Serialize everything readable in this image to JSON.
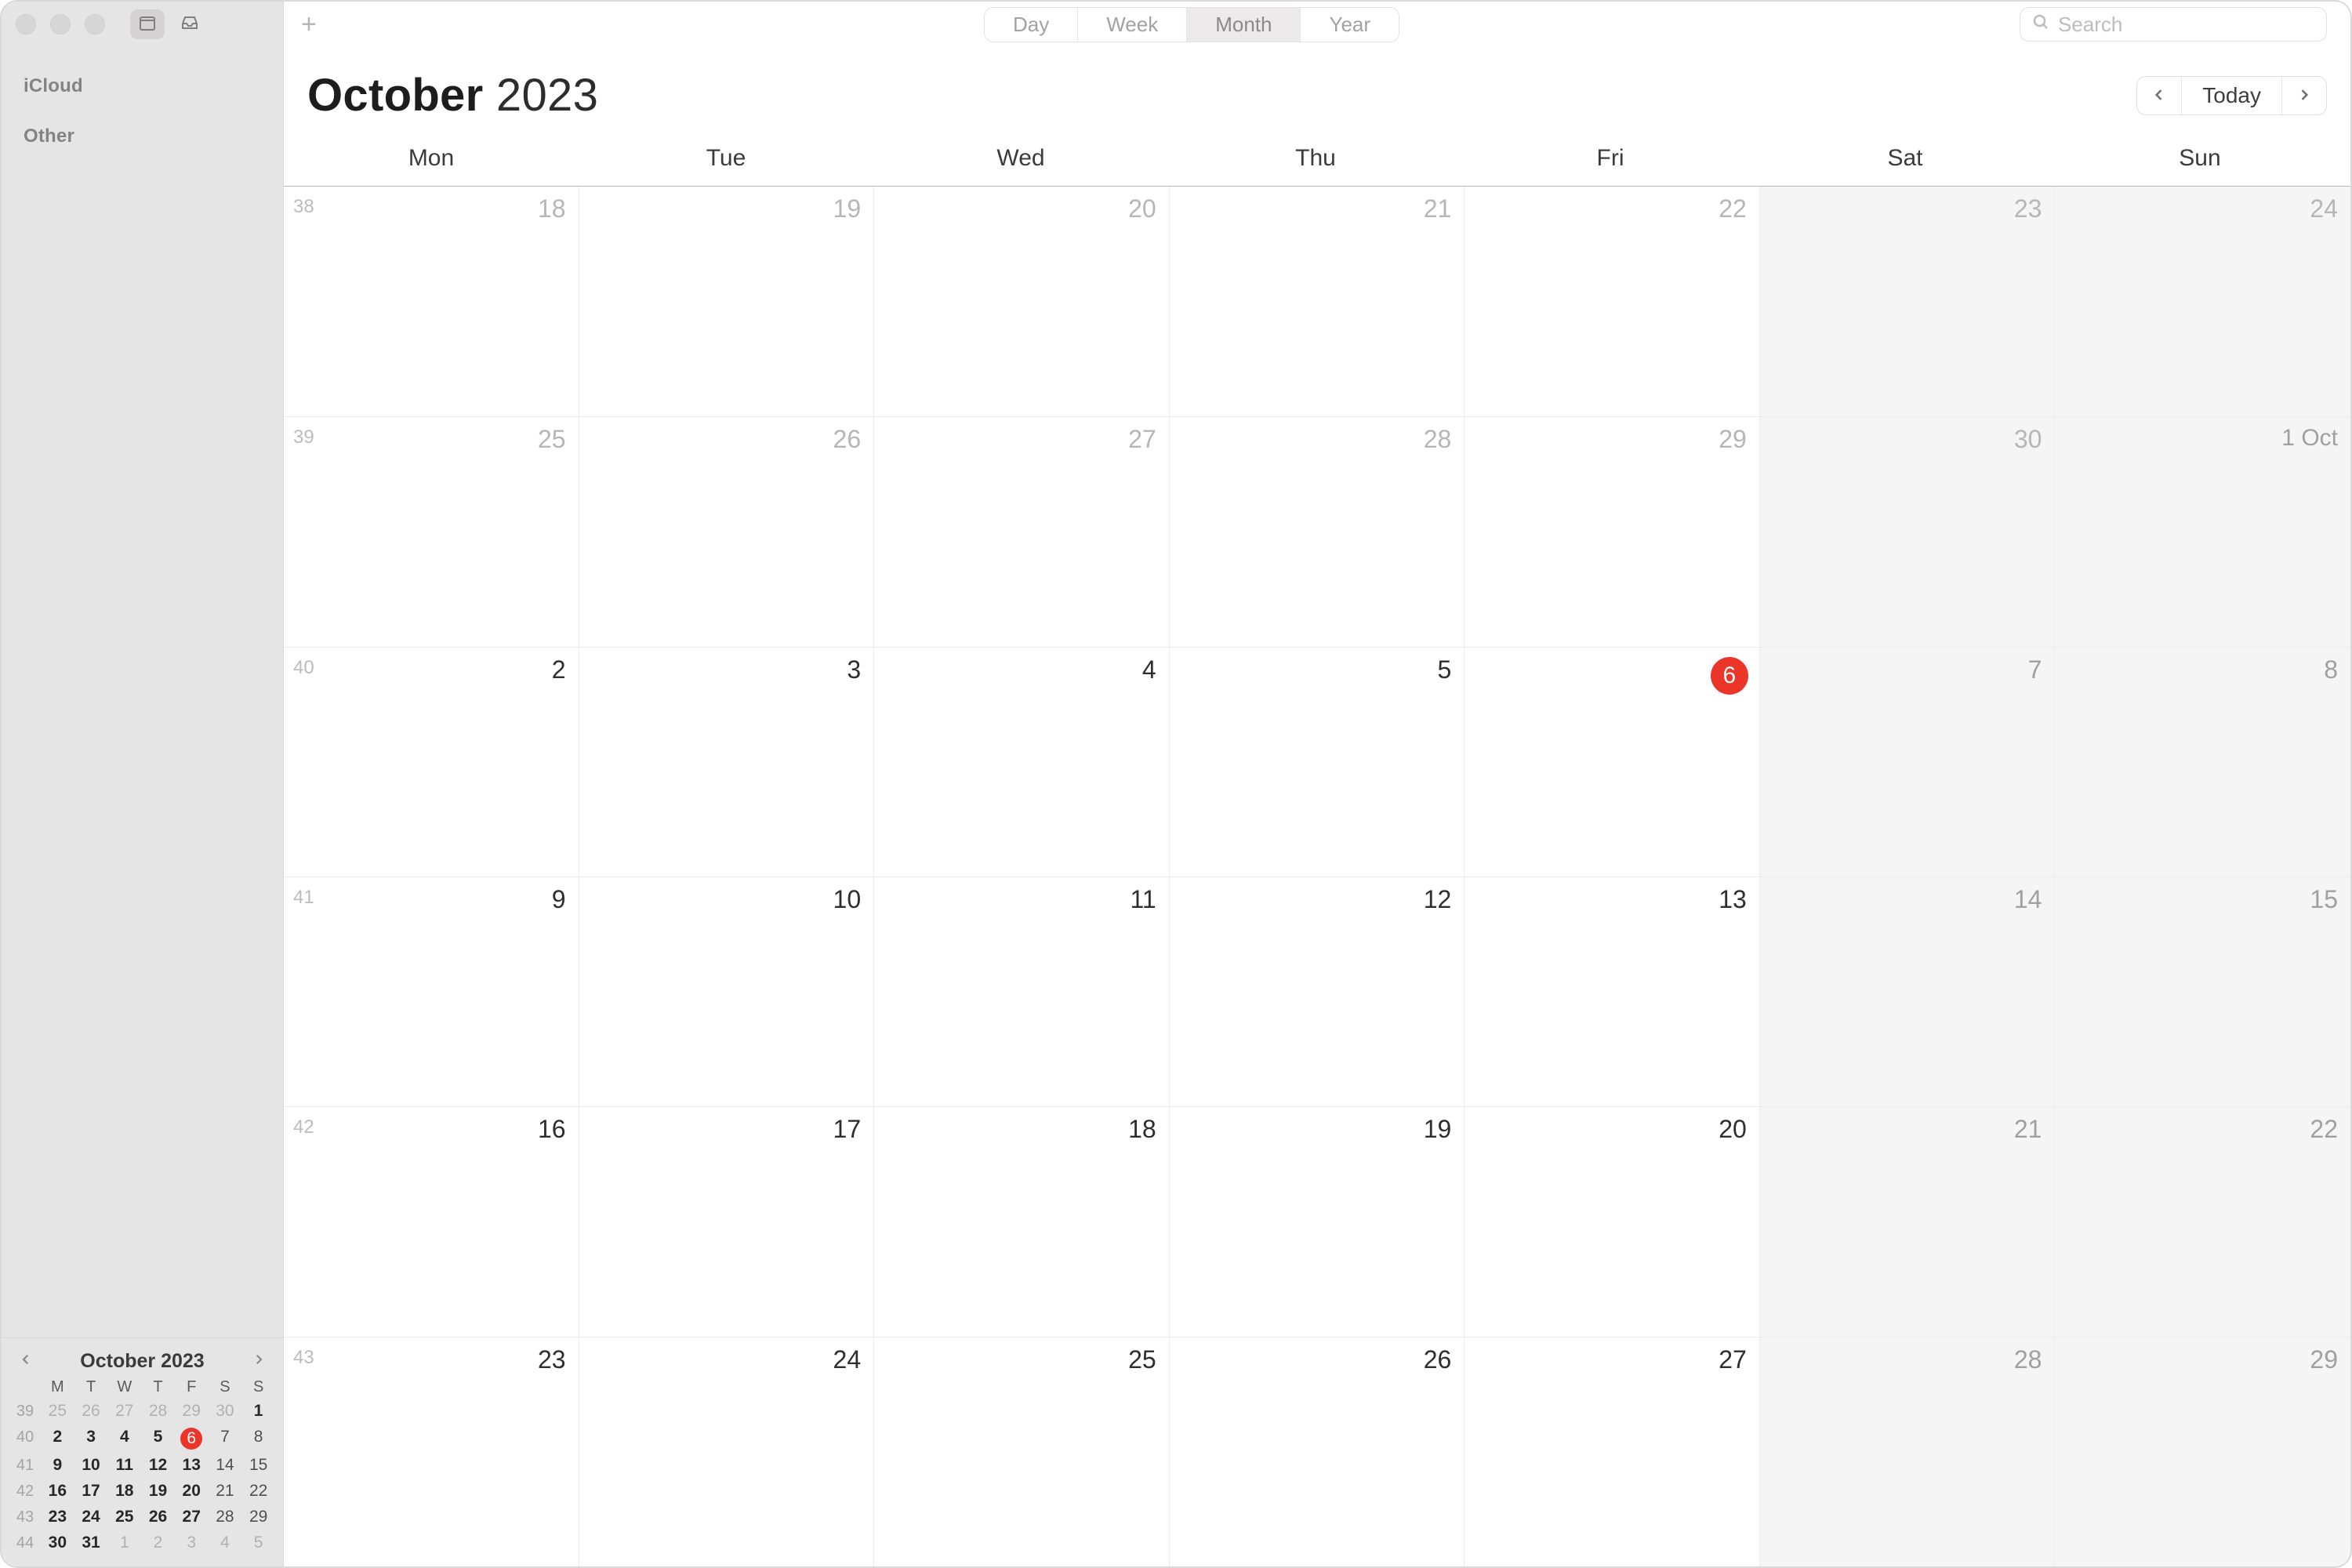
{
  "titlebar": {
    "sidebar_icon": "calendars-icon",
    "inbox_icon": "tray-icon"
  },
  "sidebar": {
    "sections": [
      "iCloud",
      "Other"
    ]
  },
  "toolbar": {
    "views": [
      "Day",
      "Week",
      "Month",
      "Year"
    ],
    "active_view": "Month",
    "search_placeholder": "Search"
  },
  "header": {
    "month": "October",
    "year": "2023",
    "today_label": "Today"
  },
  "day_headers": [
    "Mon",
    "Tue",
    "Wed",
    "Thu",
    "Fri",
    "Sat",
    "Sun"
  ],
  "weeks": [
    {
      "wk": "38",
      "days": [
        {
          "n": "18",
          "dim": true
        },
        {
          "n": "19",
          "dim": true
        },
        {
          "n": "20",
          "dim": true
        },
        {
          "n": "21",
          "dim": true
        },
        {
          "n": "22",
          "dim": true
        },
        {
          "n": "23",
          "dim": true,
          "weekend": true
        },
        {
          "n": "24",
          "dim": true,
          "weekend": true
        }
      ]
    },
    {
      "wk": "39",
      "days": [
        {
          "n": "25",
          "dim": true
        },
        {
          "n": "26",
          "dim": true
        },
        {
          "n": "27",
          "dim": true
        },
        {
          "n": "28",
          "dim": true
        },
        {
          "n": "29",
          "dim": true
        },
        {
          "n": "30",
          "dim": true,
          "weekend": true
        },
        {
          "n": "1 Oct",
          "weekend": true,
          "first": true
        }
      ]
    },
    {
      "wk": "40",
      "days": [
        {
          "n": "2"
        },
        {
          "n": "3"
        },
        {
          "n": "4"
        },
        {
          "n": "5"
        },
        {
          "n": "6",
          "today": true
        },
        {
          "n": "7",
          "weekend": true
        },
        {
          "n": "8",
          "weekend": true
        }
      ]
    },
    {
      "wk": "41",
      "days": [
        {
          "n": "9"
        },
        {
          "n": "10"
        },
        {
          "n": "11"
        },
        {
          "n": "12"
        },
        {
          "n": "13"
        },
        {
          "n": "14",
          "weekend": true
        },
        {
          "n": "15",
          "weekend": true
        }
      ]
    },
    {
      "wk": "42",
      "days": [
        {
          "n": "16"
        },
        {
          "n": "17"
        },
        {
          "n": "18"
        },
        {
          "n": "19"
        },
        {
          "n": "20"
        },
        {
          "n": "21",
          "weekend": true
        },
        {
          "n": "22",
          "weekend": true
        }
      ]
    },
    {
      "wk": "43",
      "days": [
        {
          "n": "23"
        },
        {
          "n": "24"
        },
        {
          "n": "25"
        },
        {
          "n": "26"
        },
        {
          "n": "27"
        },
        {
          "n": "28",
          "weekend": true
        },
        {
          "n": "29",
          "weekend": true
        }
      ]
    }
  ],
  "mini": {
    "title": "October 2023",
    "hdr": [
      "M",
      "T",
      "W",
      "T",
      "F",
      "S",
      "S"
    ],
    "rows": [
      {
        "wk": "39",
        "d": [
          {
            "n": "25",
            "dim": true
          },
          {
            "n": "26",
            "dim": true
          },
          {
            "n": "27",
            "dim": true
          },
          {
            "n": "28",
            "dim": true
          },
          {
            "n": "29",
            "dim": true
          },
          {
            "n": "30",
            "dim": true
          },
          {
            "n": "1",
            "bold": true
          }
        ]
      },
      {
        "wk": "40",
        "d": [
          {
            "n": "2",
            "bold": true
          },
          {
            "n": "3",
            "bold": true
          },
          {
            "n": "4",
            "bold": true
          },
          {
            "n": "5",
            "bold": true
          },
          {
            "n": "6",
            "today": true
          },
          {
            "n": "7"
          },
          {
            "n": "8"
          }
        ]
      },
      {
        "wk": "41",
        "d": [
          {
            "n": "9",
            "bold": true
          },
          {
            "n": "10",
            "bold": true
          },
          {
            "n": "11",
            "bold": true
          },
          {
            "n": "12",
            "bold": true
          },
          {
            "n": "13",
            "bold": true
          },
          {
            "n": "14"
          },
          {
            "n": "15"
          }
        ]
      },
      {
        "wk": "42",
        "d": [
          {
            "n": "16",
            "bold": true
          },
          {
            "n": "17",
            "bold": true
          },
          {
            "n": "18",
            "bold": true
          },
          {
            "n": "19",
            "bold": true
          },
          {
            "n": "20",
            "bold": true
          },
          {
            "n": "21"
          },
          {
            "n": "22"
          }
        ]
      },
      {
        "wk": "43",
        "d": [
          {
            "n": "23",
            "bold": true
          },
          {
            "n": "24",
            "bold": true
          },
          {
            "n": "25",
            "bold": true
          },
          {
            "n": "26",
            "bold": true
          },
          {
            "n": "27",
            "bold": true
          },
          {
            "n": "28"
          },
          {
            "n": "29"
          }
        ]
      },
      {
        "wk": "44",
        "d": [
          {
            "n": "30",
            "bold": true
          },
          {
            "n": "31",
            "bold": true
          },
          {
            "n": "1",
            "dim": true
          },
          {
            "n": "2",
            "dim": true
          },
          {
            "n": "3",
            "dim": true
          },
          {
            "n": "4",
            "dim": true
          },
          {
            "n": "5",
            "dim": true
          }
        ]
      }
    ]
  }
}
